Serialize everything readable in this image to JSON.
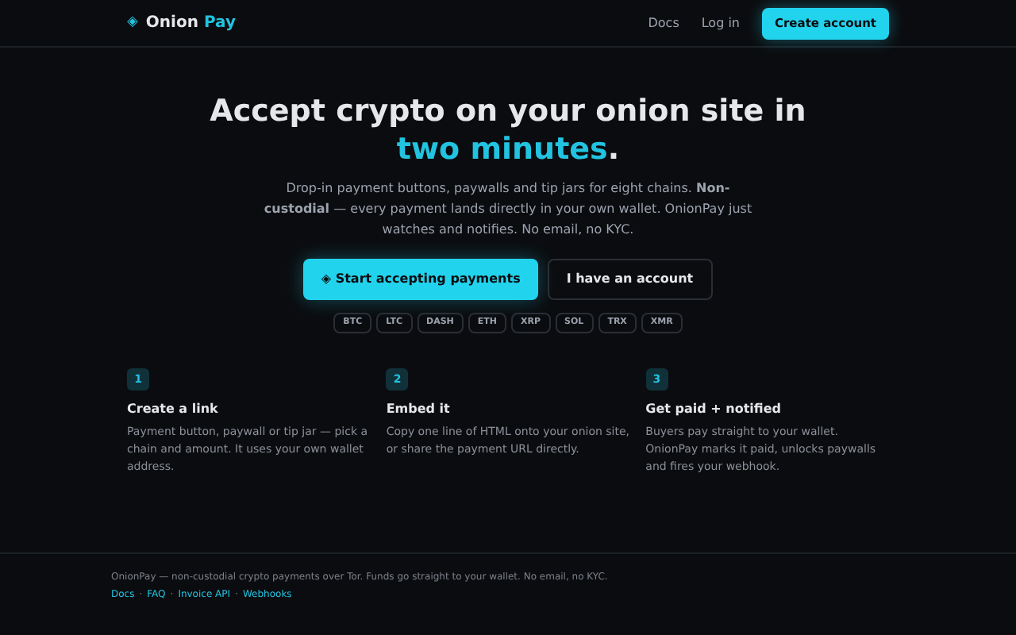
{
  "header": {
    "logo_mark": "◈",
    "brand_first": "Onion",
    "brand_second": "Pay",
    "nav": [
      "Docs",
      "Log in"
    ],
    "cta": "Create account"
  },
  "hero": {
    "title": "Accept crypto on your onion site in",
    "title_accent": "two minutes",
    "title_end": ".",
    "lead": "Drop-in payment buttons, paywalls and tip jars for eight chains. **Non-custodial** — every payment lands directly in your own wallet. OnionPay just watches and notifies. No email, no KYC.",
    "primary_mark": "◈",
    "primary": "Start accepting payments",
    "secondary": "I have an account",
    "chains": [
      "BTC",
      "LTC",
      "DASH",
      "ETH",
      "XRP",
      "SOL",
      "TRX",
      "XMR"
    ]
  },
  "steps": [
    {
      "number": "1",
      "title": "Create a link",
      "text": "Payment button, paywall or tip jar — pick a chain and amount. It uses your own wallet address."
    },
    {
      "number": "2",
      "title": "Embed it",
      "text": "Copy one line of HTML onto your onion site, or share the payment URL directly."
    },
    {
      "number": "3",
      "title": "Get paid + notified",
      "text": "Buyers pay straight to your wallet. OnionPay marks it paid, unlocks paywalls and fires your webhook."
    }
  ],
  "footer": {
    "text": "OnionPay — non-custodial crypto payments over Tor. Funds go straight to your wallet. No email, no KYC.",
    "links": [
      "Docs",
      "FAQ",
      "Invoice API",
      "Webhooks"
    ],
    "separator": "·"
  }
}
